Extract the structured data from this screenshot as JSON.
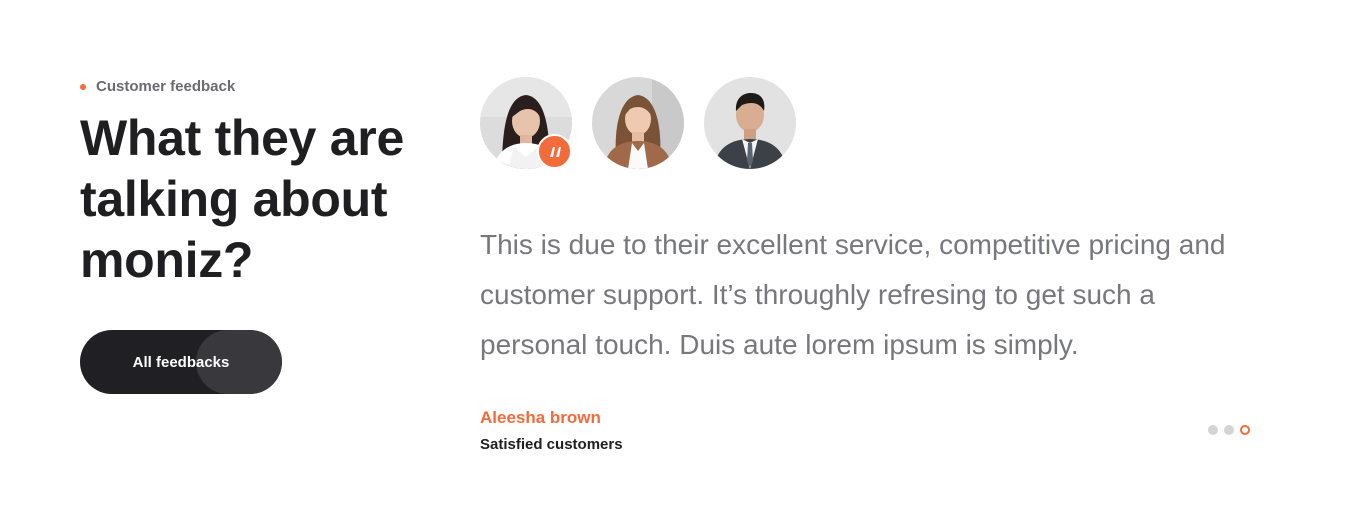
{
  "section": {
    "eyebrow": "Customer feedback",
    "headline": "What they are talking about moniz?",
    "button_label": "All feedbacks"
  },
  "avatars": [
    {
      "name": "female-avatar-1",
      "active": true
    },
    {
      "name": "female-avatar-2",
      "active": false
    },
    {
      "name": "male-avatar",
      "active": false
    }
  ],
  "testimonial": {
    "quote": "This is due to their excellent service, competitive pricing and customer support. It’s throughly refresing to get such a personal touch. Duis aute lorem ipsum is simply.",
    "author_name": "Aleesha brown",
    "author_role": "Satisfied customers"
  },
  "pager": {
    "count": 3,
    "active_index": 2
  },
  "colors": {
    "accent": "#f26b3a",
    "dark": "#1f1f24",
    "text_muted": "#77777e"
  },
  "icons": {
    "quote_badge": "quote-icon"
  }
}
